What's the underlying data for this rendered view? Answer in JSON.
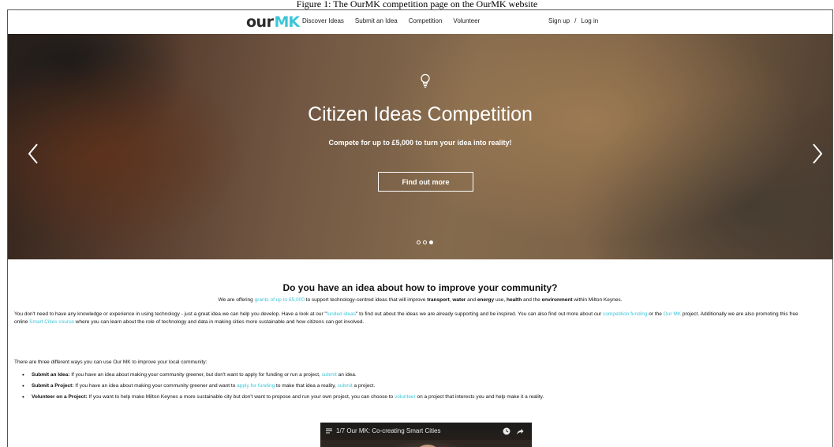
{
  "page": {
    "caption": "Figure 1: The OurMK competition page on the OurMK website"
  },
  "nav": {
    "logo_part1": "our",
    "logo_part2": "MK",
    "links": [
      "Discover Ideas",
      "Submit an Idea",
      "Competition",
      "Volunteer"
    ],
    "signup": "Sign up",
    "separator": "/",
    "login": "Log in"
  },
  "hero": {
    "icon": "lightbulb-icon",
    "title": "Citizen Ideas Competition",
    "subtitle": "Compete for up to £5,000 to turn your idea into reality!",
    "button": "Find out more",
    "slide_count": 3,
    "active_slide": 3
  },
  "content": {
    "heading": "Do you have an idea about how to improve your community?",
    "intro": {
      "t1": "We are offering ",
      "link1": "grants of up to £5,000",
      "t2": " to support technology-centred ideas that will improve ",
      "b1": "transport",
      "t3": ", ",
      "b2": "water",
      "t4": " and ",
      "b3": "energy",
      "t5": " use, ",
      "b4": "health",
      "t6": " and the ",
      "b5": "environment",
      "t7": " within Milton Keynes."
    },
    "paragraph": {
      "t1": "You don't need to have any knowledge or experience in using technology - just a great idea we can help you develop. Have a look at our \"",
      "link1": "funded ideas",
      "t2": "\" to find out about the ideas we are already supporting and be inspired. You can also find out more about our ",
      "link2": "competition funding",
      "t3": " or the ",
      "link3": "Our MK",
      "t4": " project. Additionally we are also promoting this free online ",
      "link4": "Smart Cities course",
      "t5": " where you can learn about the role of technology and data in making cities more sustainable and how citizens can get involved."
    },
    "ways_intro": "There are three different ways you can use Our MK to improve your local community:",
    "bullets": [
      {
        "bold": "Submit an Idea:",
        "t1": " If you have an idea about making your community greener, but don't want to apply for funding or run a project, ",
        "link1": "submit",
        "t2": " an idea."
      },
      {
        "bold": "Submit a Project:",
        "t1": " If you have an idea about making your community greener and want to ",
        "link1": "apply for funding",
        "t2": " to make that idea a reality, ",
        "link2": "submit",
        "t3": " a project."
      },
      {
        "bold": "Volunteer on a Project:",
        "t1": " If you want to help make Milton Keynes a more sustainable city but don't want to propose and run your own project, you can choose to ",
        "link1": "volunteer",
        "t2": " on a project that interests you and help make it a reality."
      }
    ]
  },
  "video": {
    "title": "1/7  Our MK: Co-creating Smart Cities",
    "icons": [
      "playlist-icon",
      "clock-icon",
      "share-icon"
    ]
  },
  "colors": {
    "accent": "#3ec6d8",
    "text": "#111111",
    "background": "#ffffff"
  }
}
